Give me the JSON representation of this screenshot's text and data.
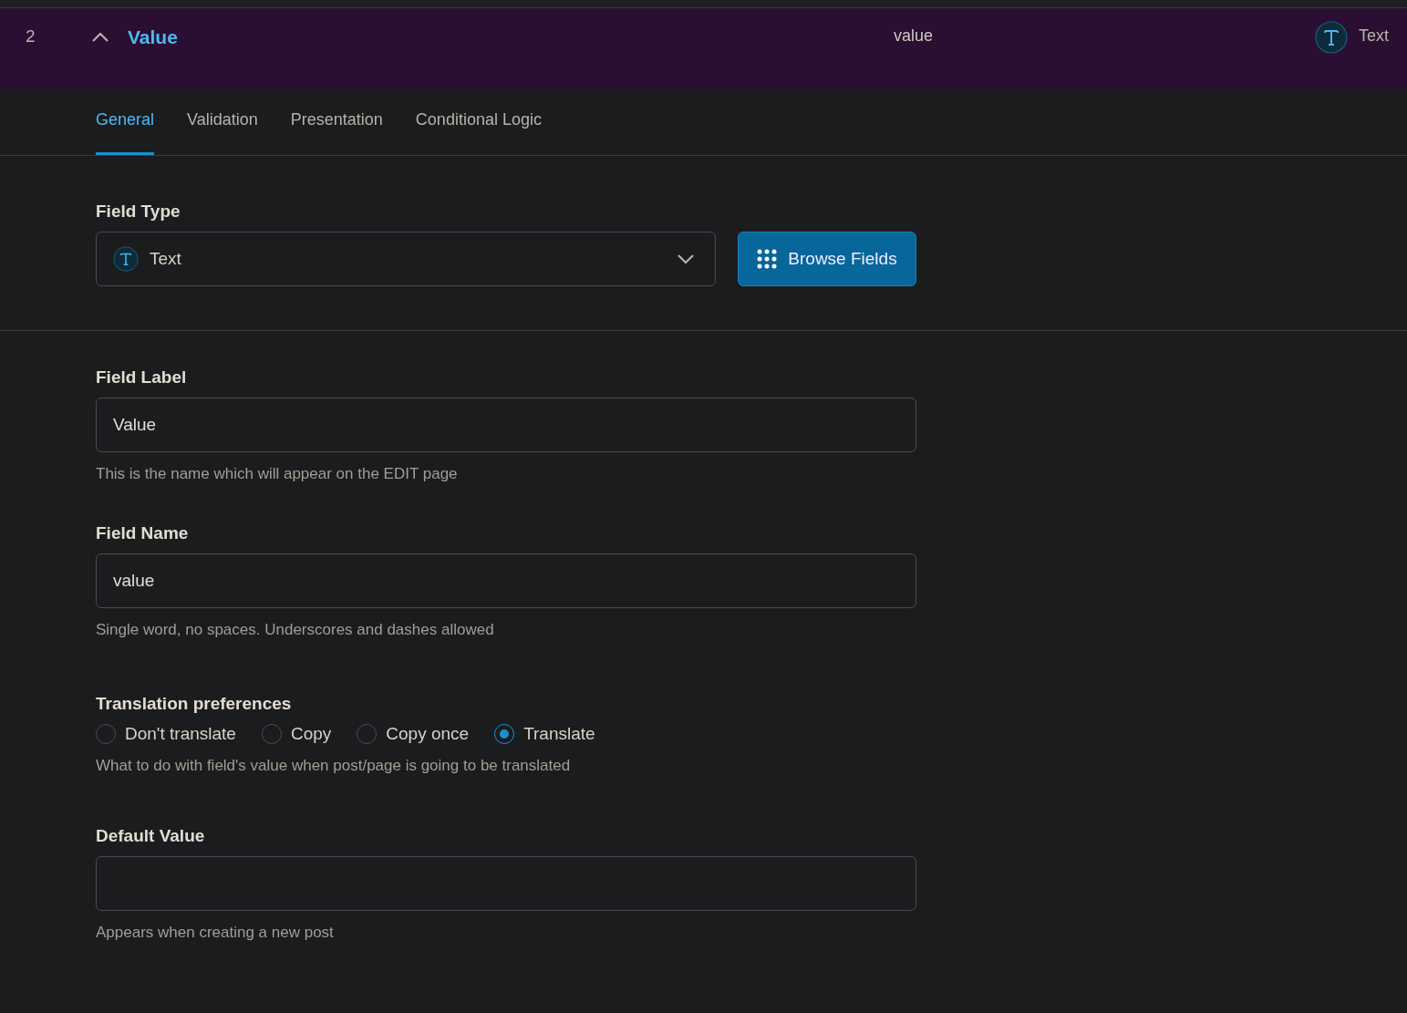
{
  "header": {
    "number": "2",
    "expanded": true,
    "title": "Value",
    "name": "value",
    "type_label": "Text"
  },
  "tabs": [
    {
      "label": "General",
      "selected": true
    },
    {
      "label": "Validation",
      "selected": false
    },
    {
      "label": "Presentation",
      "selected": false
    },
    {
      "label": "Conditional Logic",
      "selected": false
    }
  ],
  "field_type": {
    "label": "Field Type",
    "value": "Text",
    "browse_button": "Browse Fields"
  },
  "fields": [
    {
      "kind": "text",
      "label": "Field Label",
      "value": "Value",
      "help": "This is the name which will appear on the EDIT page"
    },
    {
      "kind": "text",
      "label": "Field Name",
      "value": "value",
      "help": "Single word, no spaces. Underscores and dashes allowed"
    },
    {
      "kind": "radio",
      "label": "Translation preferences",
      "options": [
        {
          "label": "Don't translate",
          "selected": false
        },
        {
          "label": "Copy",
          "selected": false
        },
        {
          "label": "Copy once",
          "selected": false
        },
        {
          "label": "Translate",
          "selected": true
        }
      ],
      "help": "What to do with field's value when post/page is going to be translated"
    },
    {
      "kind": "text",
      "label": "Default Value",
      "help": "Appears when creating a new post"
    }
  ]
}
